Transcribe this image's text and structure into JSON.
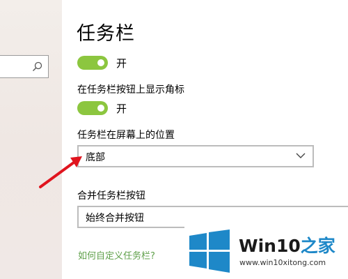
{
  "search": {
    "placeholder": "",
    "value": ""
  },
  "page": {
    "title": "任务栏"
  },
  "toggles": [
    {
      "state_label": "开",
      "on": true
    },
    {
      "state_label": "开",
      "on": true
    }
  ],
  "settings": {
    "show_badges_label": "在任务栏按钮上显示角标",
    "position_label": "任务栏在屏幕上的位置",
    "position_value": "底部",
    "combine_label": "合并任务栏按钮",
    "combine_value": "始终合并按钮"
  },
  "help": {
    "link_text": "如何自定义任务栏?"
  },
  "colors": {
    "accent_toggle": "#8cc63f",
    "link": "#5fa04a",
    "arrow": "#e0141e",
    "logo_blue": "#1e88c8"
  },
  "watermark": {
    "brand_latin": "Win10",
    "brand_zh": "之家",
    "url": "www.win10xitong.com"
  }
}
